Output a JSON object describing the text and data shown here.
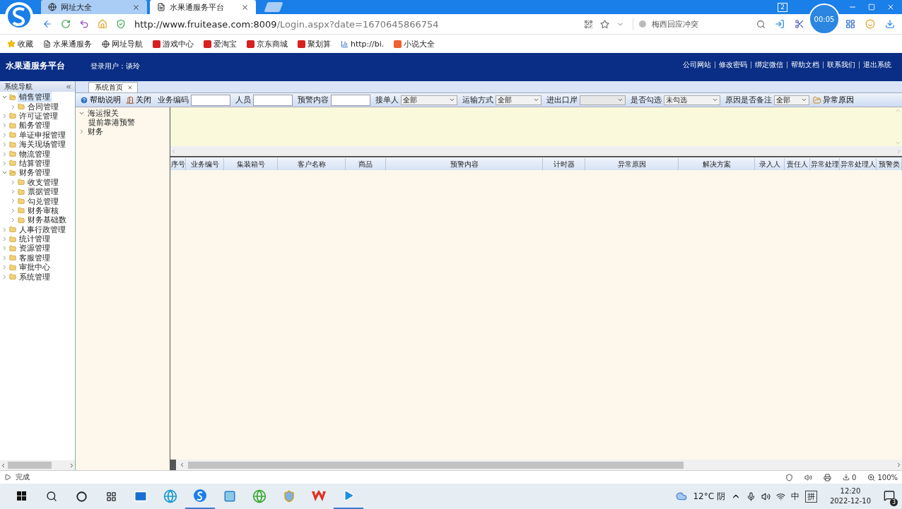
{
  "browser": {
    "tabs": [
      {
        "title": "网址大全",
        "selected": false
      },
      {
        "title": "水果通服务平台",
        "selected": true
      }
    ],
    "tab_counter": "2",
    "timer": "00:05",
    "url": {
      "host": "http://www.fruitease.com:8009",
      "path": "/Login.aspx?date=1670645866754"
    },
    "search": {
      "placeholder": "梅西回应冲突"
    },
    "bookmarks": [
      "收藏",
      "水果通服务",
      "网址导航",
      "游戏中心",
      "爱淘宝",
      "京东商城",
      "聚划算",
      "http://bi.",
      "小说大全"
    ]
  },
  "app": {
    "title": "水果通服务平台",
    "user": "登录用户：谈玲",
    "links": [
      "公司网站",
      "修改密码",
      "绑定微信",
      "帮助文档",
      "联系我们",
      "退出系统"
    ]
  },
  "nav": {
    "title": "系统导航",
    "items": [
      {
        "label": "销售管理",
        "expanded": true,
        "selected": true,
        "children": [
          {
            "label": "合同管理",
            "expanded": false,
            "selected": false
          }
        ]
      },
      {
        "label": "许可证管理",
        "expanded": false,
        "selected": false
      },
      {
        "label": "船务管理",
        "expanded": false,
        "selected": false
      },
      {
        "label": "单证申报管理",
        "expanded": false,
        "selected": false
      },
      {
        "label": "海关现场管理",
        "expanded": false,
        "selected": false
      },
      {
        "label": "物流管理",
        "expanded": false,
        "selected": false
      },
      {
        "label": "结算管理",
        "expanded": false,
        "selected": false
      },
      {
        "label": "财务管理",
        "expanded": true,
        "selected": false,
        "children": [
          {
            "label": "收支管理",
            "expanded": false,
            "selected": false
          },
          {
            "label": "票据管理",
            "expanded": false,
            "selected": false
          },
          {
            "label": "勾兑管理",
            "expanded": false,
            "selected": false
          },
          {
            "label": "财务审核",
            "expanded": false,
            "selected": false
          },
          {
            "label": "财务基础数",
            "expanded": false,
            "selected": false
          }
        ]
      },
      {
        "label": "人事行政管理",
        "expanded": false,
        "selected": false
      },
      {
        "label": "统计管理",
        "expanded": false,
        "selected": false
      },
      {
        "label": "资源管理",
        "expanded": false,
        "selected": false
      },
      {
        "label": "客服管理",
        "expanded": false,
        "selected": false
      },
      {
        "label": "审批中心",
        "expanded": false,
        "selected": false
      },
      {
        "label": "系统管理",
        "expanded": false,
        "selected": false
      }
    ]
  },
  "page_tabs": [
    {
      "label": "系统首页",
      "selected": true
    }
  ],
  "toolbar": {
    "help": "帮助说明",
    "close": "关闭",
    "filters": [
      {
        "kind": "input",
        "label": "业务编码"
      },
      {
        "kind": "input",
        "label": "人员"
      },
      {
        "kind": "input",
        "label": "预警内容"
      },
      {
        "kind": "select",
        "label": "接单人",
        "value": "全部"
      },
      {
        "kind": "select",
        "label": "运输方式",
        "value": "全部"
      },
      {
        "kind": "select",
        "label": "进出口岸"
      },
      {
        "kind": "select",
        "label": "是否勾选",
        "value": "未勾选"
      },
      {
        "kind": "select",
        "label": "原因是否备注",
        "value": "全部"
      }
    ],
    "reason_button": "异常原因"
  },
  "alert_tree": [
    {
      "label": "海运报关",
      "expanded": true,
      "children": [
        {
          "label": "提前靠港预警"
        }
      ]
    },
    {
      "label": "财务",
      "expanded": false
    }
  ],
  "table": {
    "columns": [
      "序号",
      "业务编号",
      "集装箱号",
      "客户名称",
      "商品",
      "预警内容",
      "计时器",
      "异常原因",
      "解决方案",
      "录入人",
      "责任人",
      "异常处理",
      "异常处理人",
      "预警类"
    ]
  },
  "status_bar": {
    "text": "完成",
    "counter": "0",
    "zoom": "100%"
  },
  "taskbar": {
    "weather": "12°C 阴",
    "ime": "中",
    "ime_mode": "拼",
    "time": "12:20",
    "date": "2022-12-10",
    "notifications": "3"
  }
}
